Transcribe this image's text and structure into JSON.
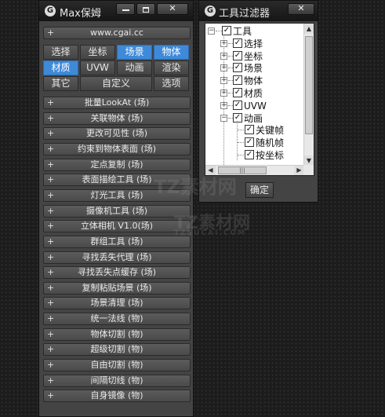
{
  "main_window": {
    "title": "Max保姆",
    "close_glyph": "✕",
    "url": "www.cgai.cc",
    "categories": [
      {
        "label": "选择",
        "active": false
      },
      {
        "label": "坐标",
        "active": false
      },
      {
        "label": "场景",
        "active": true
      },
      {
        "label": "物体",
        "active": true
      },
      {
        "label": "材质",
        "active": true
      },
      {
        "label": "UVW",
        "active": false
      },
      {
        "label": "动画",
        "active": false
      },
      {
        "label": "渲染",
        "active": false
      },
      {
        "label": "其它",
        "active": false
      },
      {
        "label": "自定义",
        "active": false
      },
      {
        "label": "选项",
        "active": false
      }
    ],
    "tools": [
      "批量LookAt (场)",
      "关联物体 (场)",
      "更改可见性 (场)",
      "约束到物体表面 (场)",
      "定点复制 (场)",
      "表面描绘工具 (场)",
      "灯光工具 (场)",
      "摄像机工具 (场)",
      "立体相机 V1.0(场)",
      "群组工具 (场)",
      "寻找丢失代理 (场)",
      "寻找丢失点缓存 (场)",
      "复制粘贴场景 (场)",
      "场景清理 (场)",
      "统一法线 (物)",
      "物体切割 (物)",
      "超级切割 (物)",
      "自由切割 (物)",
      "间隔切线 (物)",
      "自身镜像 (物)"
    ],
    "expand_glyph": "+"
  },
  "filter_window": {
    "title": "工具过滤器",
    "close_glyph": "✕",
    "root": "工具",
    "items": [
      "选择",
      "坐标",
      "场景",
      "物体",
      "材质",
      "UVW",
      "动画"
    ],
    "sub_items": [
      "关键帧",
      "随机帧",
      "按坐标"
    ],
    "ok_label": "确定"
  },
  "watermark": {
    "line1": "TZ素材网",
    "line2": "TZSUCAI.COM"
  },
  "colors": {
    "active_tab": "#3f8ad8",
    "panel_bg": "#444444",
    "rollout_bg": "#545454"
  }
}
